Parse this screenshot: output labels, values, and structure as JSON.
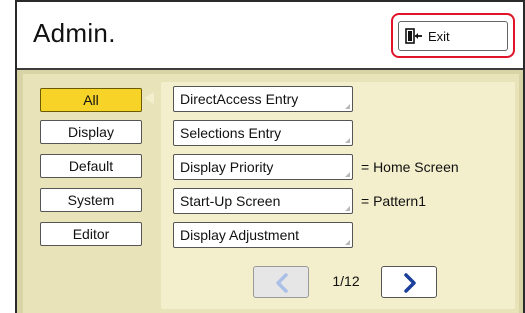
{
  "header": {
    "title": "Admin."
  },
  "exit": {
    "label": "Exit",
    "icon": "exit-door-icon",
    "highlight_color": "#e0152a"
  },
  "categories": [
    {
      "label": "All",
      "active": true
    },
    {
      "label": "Display",
      "active": false
    },
    {
      "label": "Default",
      "active": false
    },
    {
      "label": "System",
      "active": false
    },
    {
      "label": "Editor",
      "active": false
    }
  ],
  "items": [
    {
      "label": "DirectAccess Entry",
      "value": ""
    },
    {
      "label": "Selections Entry",
      "value": ""
    },
    {
      "label": "Display Priority",
      "value": "= Home Screen"
    },
    {
      "label": "Start-Up Screen",
      "value": "= Pattern1"
    },
    {
      "label": "Display Adjustment",
      "value": ""
    }
  ],
  "pager": {
    "indicator": "1/12",
    "prev_icon": "chevron-left-icon",
    "next_icon": "chevron-right-icon"
  },
  "colors": {
    "active_category": "#f7d327",
    "background": "#d9d4a6",
    "panel": "#f3efcc",
    "next_arrow": "#1c3f9c",
    "prev_arrow": "#aac0e6"
  }
}
